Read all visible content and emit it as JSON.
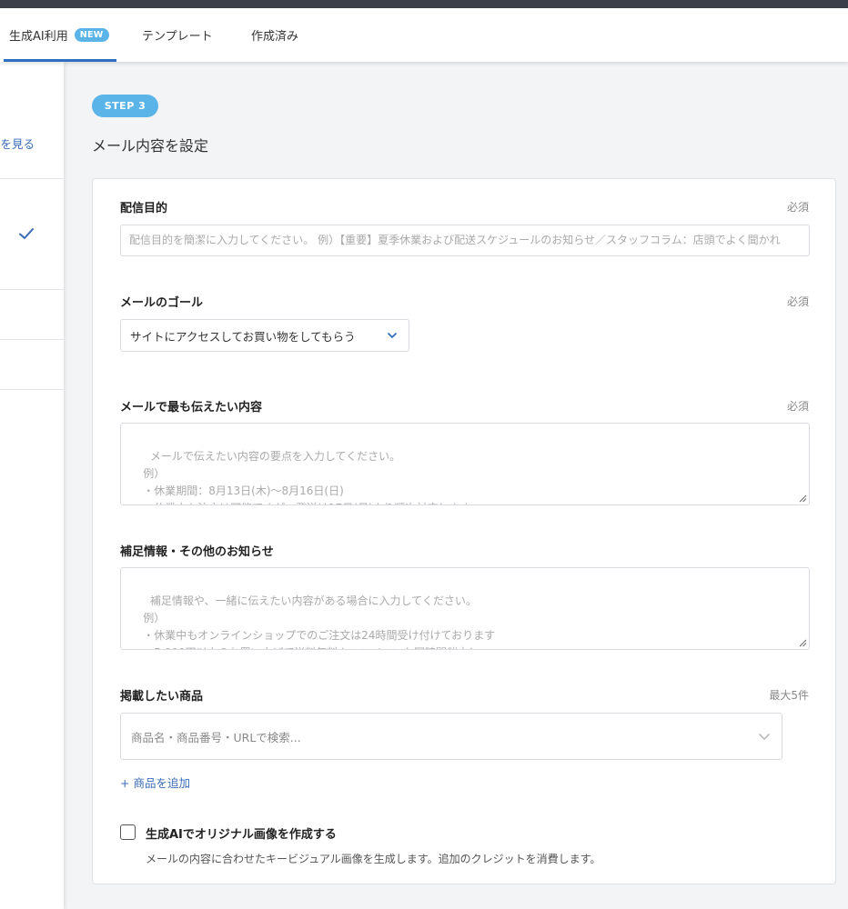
{
  "tabs": [
    {
      "label": "生成AI利用",
      "badge": "NEW",
      "active": true
    },
    {
      "label": "テンプレート"
    },
    {
      "label": "作成済み"
    }
  ],
  "sidebar": {
    "link": "例を見る"
  },
  "step": {
    "badge": "STEP 3",
    "title": "メール内容を設定"
  },
  "form": {
    "purpose": {
      "label": "配信目的",
      "required": "必須",
      "placeholder": "配信目的を簡潔に入力してください。 例）【重要】夏季休業および配送スケジュールのお知らせ／スタッフコラム：店頭でよく聞かれ"
    },
    "goal": {
      "label": "メールのゴール",
      "required": "必須",
      "selected": "サイトにアクセスしてお買い物をしてもらう"
    },
    "content": {
      "label": "メールで最も伝えたい内容",
      "required": "必須",
      "placeholder": "メールで伝えたい内容の要点を入力してください。\n    例）\n    ・休業期間：8月13日(木)〜8月16日(日)\n    ・休業中も注文は可能ですが、発送は17日(月)より順次対応します。\n    ・お急ぎの方は12日(水)までのご注文をお願いします。"
    },
    "supplement": {
      "label": "補足情報・その他のお知らせ",
      "placeholder": "補足情報や、一緒に伝えたい内容がある場合に入力してください。\n    例）\n    ・休業中もオンラインショップでのご注文は24時間受け付けております\n    ・5,000円以上のお買い上げで送料無料キャンペーンも同時開催中！\n    ・店舗のご利用は通常通り営業しております"
    },
    "products": {
      "label": "掲載したい商品",
      "limit": "最大5件",
      "search_placeholder": "商品名・商品番号・URLで検索...",
      "add_link": "+ 商品を追加"
    },
    "ai_image": {
      "label": "生成AIでオリジナル画像を作成する",
      "description": "メールの内容に合わせたキービジュアル画像を生成します。追加のクレジットを消費します。",
      "checked": false
    }
  },
  "colors": {
    "accent": "#5bb4e8",
    "link": "#3a6cb8",
    "tab_underline": "#2f6fc1"
  }
}
